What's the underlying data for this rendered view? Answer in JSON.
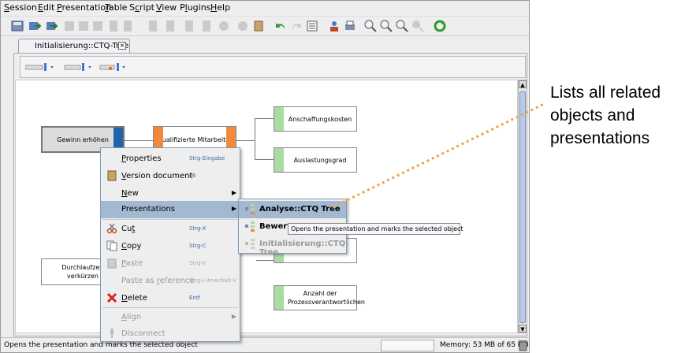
{
  "menubar": {
    "items": [
      {
        "pre": "",
        "u": "S",
        "post": "ession"
      },
      {
        "pre": "",
        "u": "E",
        "post": "dit"
      },
      {
        "pre": "",
        "u": "P",
        "post": "resentation"
      },
      {
        "pre": "",
        "u": "T",
        "post": "able"
      },
      {
        "pre": "S",
        "u": "c",
        "post": "ript"
      },
      {
        "pre": "",
        "u": "V",
        "post": "iew"
      },
      {
        "pre": "P",
        "u": "l",
        "post": "ugins"
      },
      {
        "pre": "",
        "u": "H",
        "post": "elp"
      }
    ]
  },
  "tab": {
    "label": "Initialisierung::CTQ-Tree",
    "close": "×"
  },
  "nodes": {
    "root": "Gewinn erhöhen",
    "mid": "Qualifizierte Mitarbeiter",
    "n1": "Anschaffungskosten",
    "n2": "Auslastungsgrad",
    "n3": "Durchlaufzeit verkürzen",
    "n4": "Anzahl der Prozessverantwortlichen"
  },
  "context_menu": {
    "properties": {
      "pre": "",
      "u": "P",
      "post": "roperties",
      "shortcut": "Strg-Eingabe"
    },
    "version_document": {
      "pre": "",
      "u": "V",
      "post": "ersion document",
      "shortcut": "F6"
    },
    "new": {
      "pre": "",
      "u": "N",
      "post": "ew"
    },
    "presentations": {
      "label": "Presentations"
    },
    "cut": {
      "pre": "Cu",
      "u": "t",
      "post": "",
      "shortcut": "Strg-X"
    },
    "copy": {
      "pre": "",
      "u": "C",
      "post": "opy",
      "shortcut": "Strg-C"
    },
    "paste": {
      "pre": "",
      "u": "P",
      "post": "aste",
      "shortcut": "Strg-V"
    },
    "paste_as_reference": {
      "pre": "Paste as ",
      "u": "r",
      "post": "eference",
      "shortcut": "Strg+Umschalt-V"
    },
    "delete": {
      "pre": "",
      "u": "D",
      "post": "elete",
      "shortcut": "Entf"
    },
    "align": {
      "pre": "",
      "u": "A",
      "post": "lign"
    },
    "disconnect": {
      "label": "Disconnect"
    }
  },
  "submenu": {
    "items": [
      "Analyse::CTQ Tree",
      "Bewertun",
      "Initialisierung::CTQ-Tree"
    ]
  },
  "tooltip": "Opens the presentation and marks the selected object",
  "statusbar": {
    "message": "Opens the presentation and marks the selected object",
    "memory": "Memory: 53 MB of 65 MB"
  },
  "callout": {
    "lines": [
      "Lists all related",
      "objects and",
      "presentations"
    ]
  },
  "colors": {
    "accent": "#a3b8d1",
    "callout_line": "#f0a24a",
    "node_orange": "#f08a3a",
    "node_blue": "#1e64a8",
    "node_green": "#a9dca0"
  }
}
